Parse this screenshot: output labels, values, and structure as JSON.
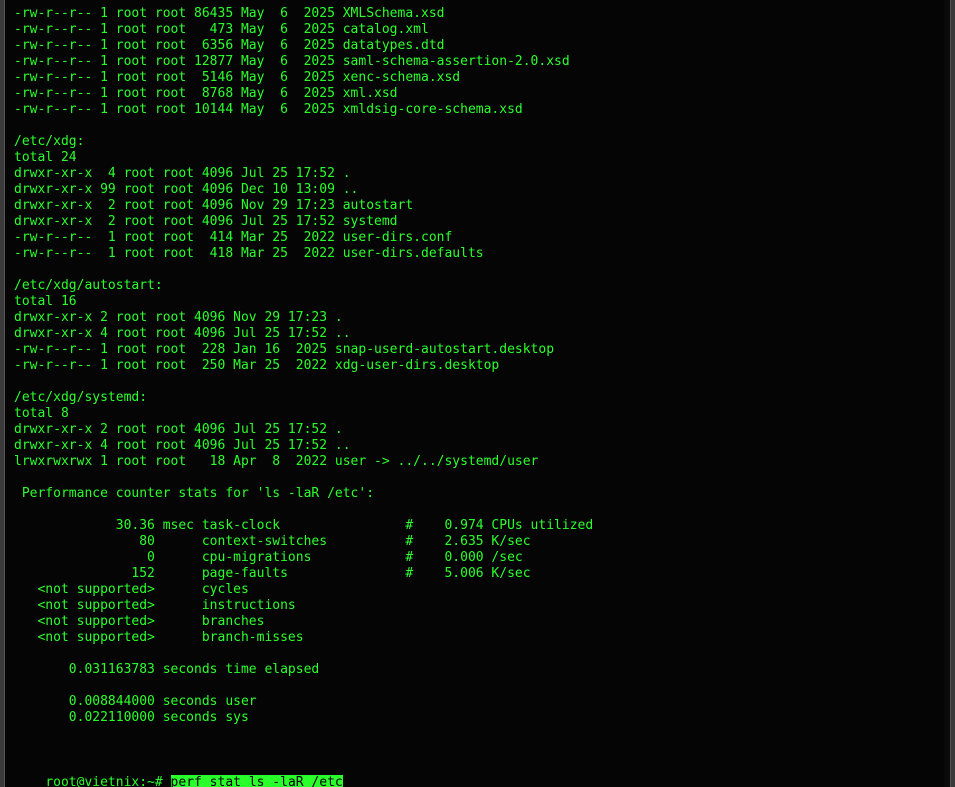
{
  "terminal": {
    "lines": [
      "-rw-r--r-- 1 root root 86435 May  6  2025 XMLSchema.xsd",
      "-rw-r--r-- 1 root root   473 May  6  2025 catalog.xml",
      "-rw-r--r-- 1 root root  6356 May  6  2025 datatypes.dtd",
      "-rw-r--r-- 1 root root 12877 May  6  2025 saml-schema-assertion-2.0.xsd",
      "-rw-r--r-- 1 root root  5146 May  6  2025 xenc-schema.xsd",
      "-rw-r--r-- 1 root root  8768 May  6  2025 xml.xsd",
      "-rw-r--r-- 1 root root 10144 May  6  2025 xmldsig-core-schema.xsd",
      "",
      "/etc/xdg:",
      "total 24",
      "drwxr-xr-x  4 root root 4096 Jul 25 17:52 .",
      "drwxr-xr-x 99 root root 4096 Dec 10 13:09 ..",
      "drwxr-xr-x  2 root root 4096 Nov 29 17:23 autostart",
      "drwxr-xr-x  2 root root 4096 Jul 25 17:52 systemd",
      "-rw-r--r--  1 root root  414 Mar 25  2022 user-dirs.conf",
      "-rw-r--r--  1 root root  418 Mar 25  2022 user-dirs.defaults",
      "",
      "/etc/xdg/autostart:",
      "total 16",
      "drwxr-xr-x 2 root root 4096 Nov 29 17:23 .",
      "drwxr-xr-x 4 root root 4096 Jul 25 17:52 ..",
      "-rw-r--r-- 1 root root  228 Jan 16  2025 snap-userd-autostart.desktop",
      "-rw-r--r-- 1 root root  250 Mar 25  2022 xdg-user-dirs.desktop",
      "",
      "/etc/xdg/systemd:",
      "total 8",
      "drwxr-xr-x 2 root root 4096 Jul 25 17:52 .",
      "drwxr-xr-x 4 root root 4096 Jul 25 17:52 ..",
      "lrwxrwxrwx 1 root root   18 Apr  8  2022 user -> ../../systemd/user",
      "",
      " Performance counter stats for 'ls -laR /etc':",
      "",
      "             30.36 msec task-clock                #    0.974 CPUs utilized",
      "                80      context-switches          #    2.635 K/sec",
      "                 0      cpu-migrations            #    0.000 /sec",
      "               152      page-faults               #    5.006 K/sec",
      "   <not supported>      cycles",
      "   <not supported>      instructions",
      "   <not supported>      branches",
      "   <not supported>      branch-misses",
      "",
      "       0.031163783 seconds time elapsed",
      "",
      "       0.008844000 seconds user",
      "       0.022110000 seconds sys",
      "",
      ""
    ],
    "prompt": "root@vietnix:~# ",
    "command": "perf stat ls -laR /etc"
  },
  "colors": {
    "background": "#050505",
    "foreground": "#2bff2b",
    "selection_bg": "#2bff2b",
    "selection_fg": "#000000"
  }
}
